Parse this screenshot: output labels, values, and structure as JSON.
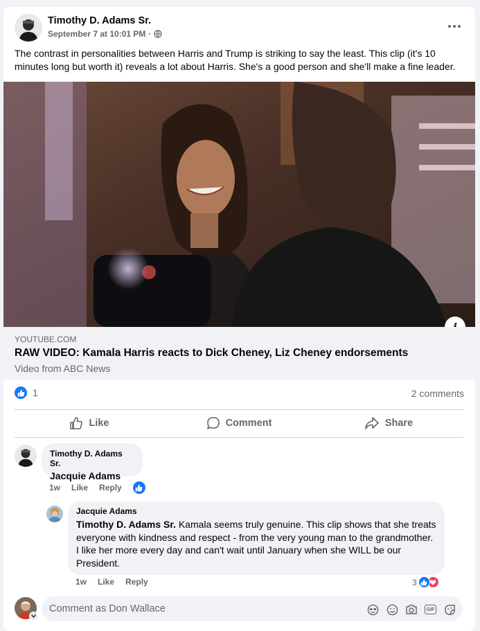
{
  "post": {
    "author": "Timothy D. Adams Sr.",
    "timestamp": "September 7 at 10:01 PM",
    "separator": "·",
    "privacy_icon": "globe-icon",
    "text": "The contrast in personalities between Harris and Trump is striking to say the least.  This clip (it's 10 minutes long but worth it) reveals a lot about Harris.  She's a good person and she'll make a fine leader."
  },
  "link": {
    "domain": "YOUTUBE.COM",
    "title": "RAW VIDEO: Kamala Harris reacts to Dick Cheney, Liz Cheney endorsements",
    "subtitle": "Video from ABC News"
  },
  "stats": {
    "reaction_count": "1",
    "comments_count": "2 comments"
  },
  "actions": {
    "like": "Like",
    "comment": "Comment",
    "share": "Share"
  },
  "comments": [
    {
      "author": "Timothy D. Adams Sr.",
      "mention": "Jacquie Adams",
      "text": "",
      "time": "1w",
      "like": "Like",
      "reply": "Reply"
    }
  ],
  "reply": {
    "author": "Jacquie Adams",
    "mention": "Timothy D. Adams Sr.",
    "text": " Kamala seems truly genuine. This clip shows that she treats everyone with kindness and respect - from the very young man to the grandmother. I like her more every day and can't wait until January when she WILL be our President.",
    "time": "1w",
    "like": "Like",
    "reply": "Reply",
    "reaction_count": "3"
  },
  "composer": {
    "placeholder": "Comment as Don Wallace"
  },
  "colors": {
    "accent": "#1877f2",
    "love": "#f33e58",
    "secondary_text": "#65676b"
  }
}
